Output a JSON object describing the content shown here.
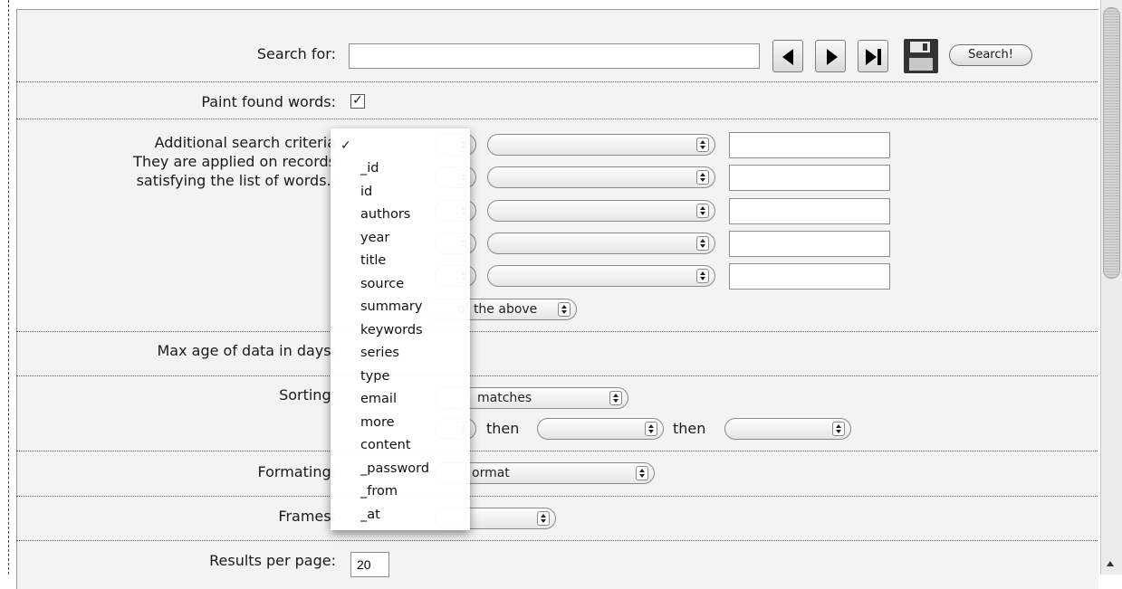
{
  "form": {
    "search_label": "Search for:",
    "search_value": "",
    "search_button": "Search!",
    "paint_label": "Paint found words:",
    "paint_checked": true,
    "criteria_label_lines": [
      "Additional search criteria",
      "They are applied on records",
      "satisfying the list of words.:"
    ],
    "criteria_combiner": "of the above",
    "max_age_label": "Max age of data in days:",
    "sorting_label": "Sorting:",
    "sorting_primary": "matches",
    "sorting_then_1": "then",
    "sorting_then_2": "then",
    "formatting_label": "Formating:",
    "formatting_value": "ormat",
    "frames_label": "Frames:",
    "results_label": "Results per page:",
    "results_value": "20"
  },
  "field_menu": {
    "checkmark": "✓",
    "items": [
      "_id",
      "id",
      "authors",
      "year",
      "title",
      "source",
      "summary",
      "keywords",
      "series",
      "type",
      "email",
      "more",
      "content",
      "_password",
      "_from",
      "_at"
    ]
  },
  "icons": {
    "prev": "triangle-left-icon",
    "next": "triangle-right-icon",
    "last": "skip-to-last-icon",
    "save": "floppy-disk-icon"
  }
}
